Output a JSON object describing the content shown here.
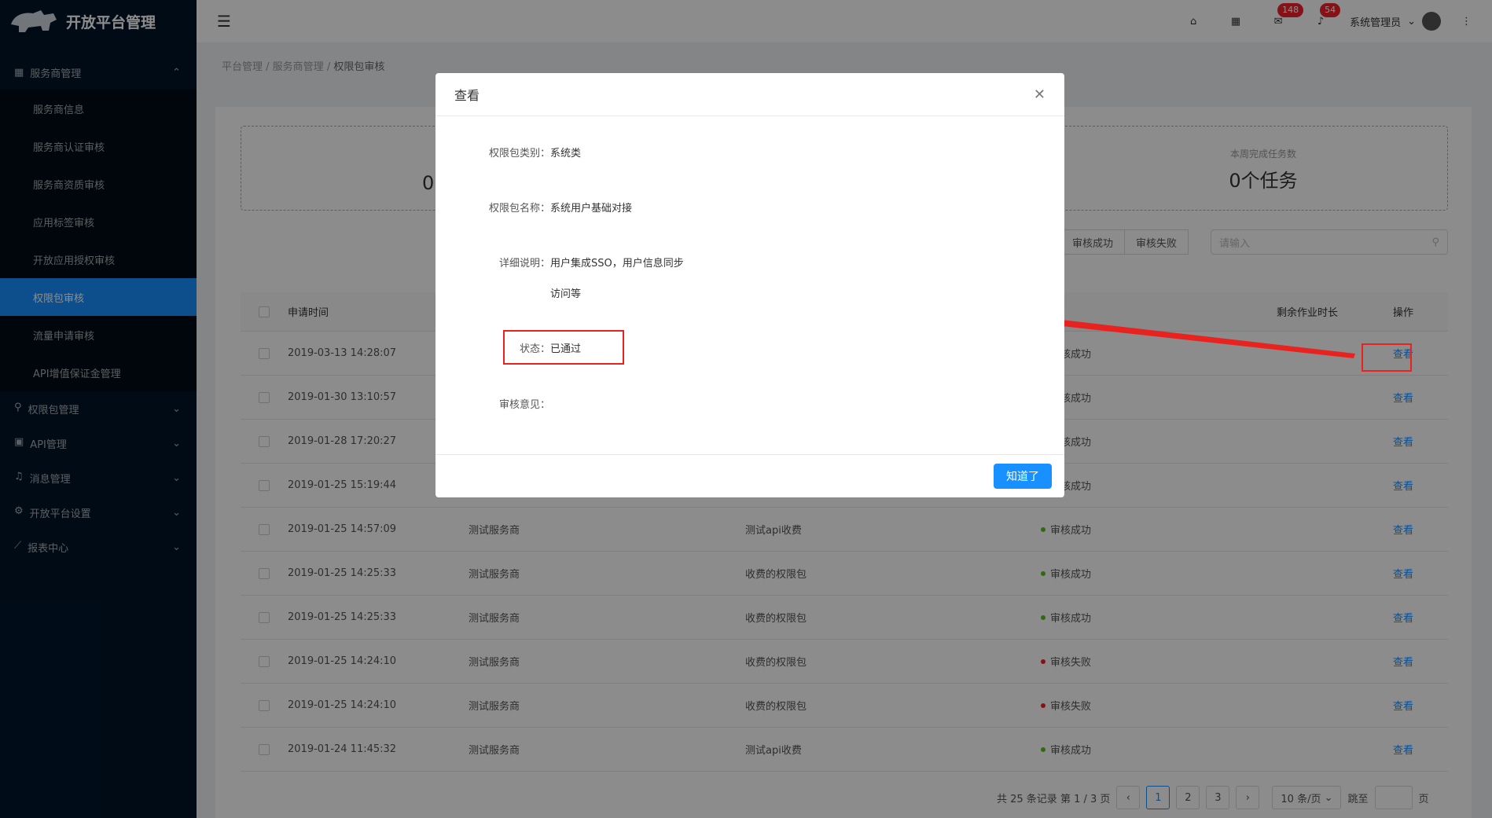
{
  "app": {
    "title": "开放平台管理"
  },
  "sidebar": {
    "group_main": "服务商管理",
    "sub_items": [
      "服务商信息",
      "服务商认证审核",
      "服务商资质审核",
      "应用标签审核",
      "开放应用授权审核",
      "权限包审核",
      "流量申请审核",
      "API增值保证金管理"
    ],
    "groups": [
      "权限包管理",
      "API管理",
      "消息管理",
      "开放平台设置",
      "报表中心"
    ]
  },
  "header": {
    "mail_count": "148",
    "bell_count": "54",
    "user": "系统管理员"
  },
  "breadcrumb": {
    "a": "平台管理",
    "b": "服务商管理",
    "c": "权限包审核"
  },
  "stats": {
    "left_value": "0",
    "week_label": "本周完成任务数",
    "week_value": "0个任务"
  },
  "filters": {
    "success": "审核成功",
    "fail": "审核失败",
    "search_placeholder": "请输入"
  },
  "table": {
    "headers": {
      "time": "申请时间",
      "status": "态",
      "remaining": "剩余作业时长",
      "op": "操作"
    },
    "rows": [
      {
        "time": "2019-03-13 14:28:07",
        "provider": "",
        "package": "",
        "status": "审核成功",
        "op": "查看"
      },
      {
        "time": "2019-01-30 13:10:57",
        "provider": "",
        "package": "",
        "status": "审核成功",
        "op": "查看"
      },
      {
        "time": "2019-01-28 17:20:27",
        "provider": "",
        "package": "",
        "status": "审核成功",
        "op": "查看"
      },
      {
        "time": "2019-01-25 15:19:44",
        "provider": "",
        "package": "",
        "status": "审核成功",
        "op": "查看"
      },
      {
        "time": "2019-01-25 14:57:09",
        "provider": "测试服务商",
        "package": "测试api收费",
        "status": "审核成功",
        "op": "查看"
      },
      {
        "time": "2019-01-25 14:25:33",
        "provider": "测试服务商",
        "package": "收费的权限包",
        "status": "审核成功",
        "op": "查看"
      },
      {
        "time": "2019-01-25 14:25:33",
        "provider": "测试服务商",
        "package": "收费的权限包",
        "status": "审核成功",
        "op": "查看"
      },
      {
        "time": "2019-01-25 14:24:10",
        "provider": "测试服务商",
        "package": "收费的权限包",
        "status": "审核失败",
        "op": "查看"
      },
      {
        "time": "2019-01-25 14:24:10",
        "provider": "测试服务商",
        "package": "收费的权限包",
        "status": "审核失败",
        "op": "查看"
      },
      {
        "time": "2019-01-24 11:45:32",
        "provider": "测试服务商",
        "package": "测试api收费",
        "status": "审核成功",
        "op": "查看"
      }
    ]
  },
  "pager": {
    "summary": "共 25 条记录 第 1 / 3 页",
    "pages": [
      "1",
      "2",
      "3"
    ],
    "page_size": "10 条/页",
    "jump": "跳至",
    "page_unit": "页"
  },
  "modal": {
    "title": "查看",
    "type_label": "权限包类别：",
    "type_value": "系统类",
    "name_label": "权限包名称：",
    "name_value": "系统用户基础对接",
    "desc_label": "详细说明：",
    "desc_value_1": "用户集成SSO，用户信息同步",
    "desc_value_2": "访问等",
    "status_label": "状态：",
    "status_value": "已通过",
    "opinion_label": "审核意见：",
    "ok": "知道了"
  },
  "colors": {
    "success": "#52c41a",
    "fail": "#f5222d",
    "primary": "#1890ff",
    "annotation": "#e8231f"
  }
}
